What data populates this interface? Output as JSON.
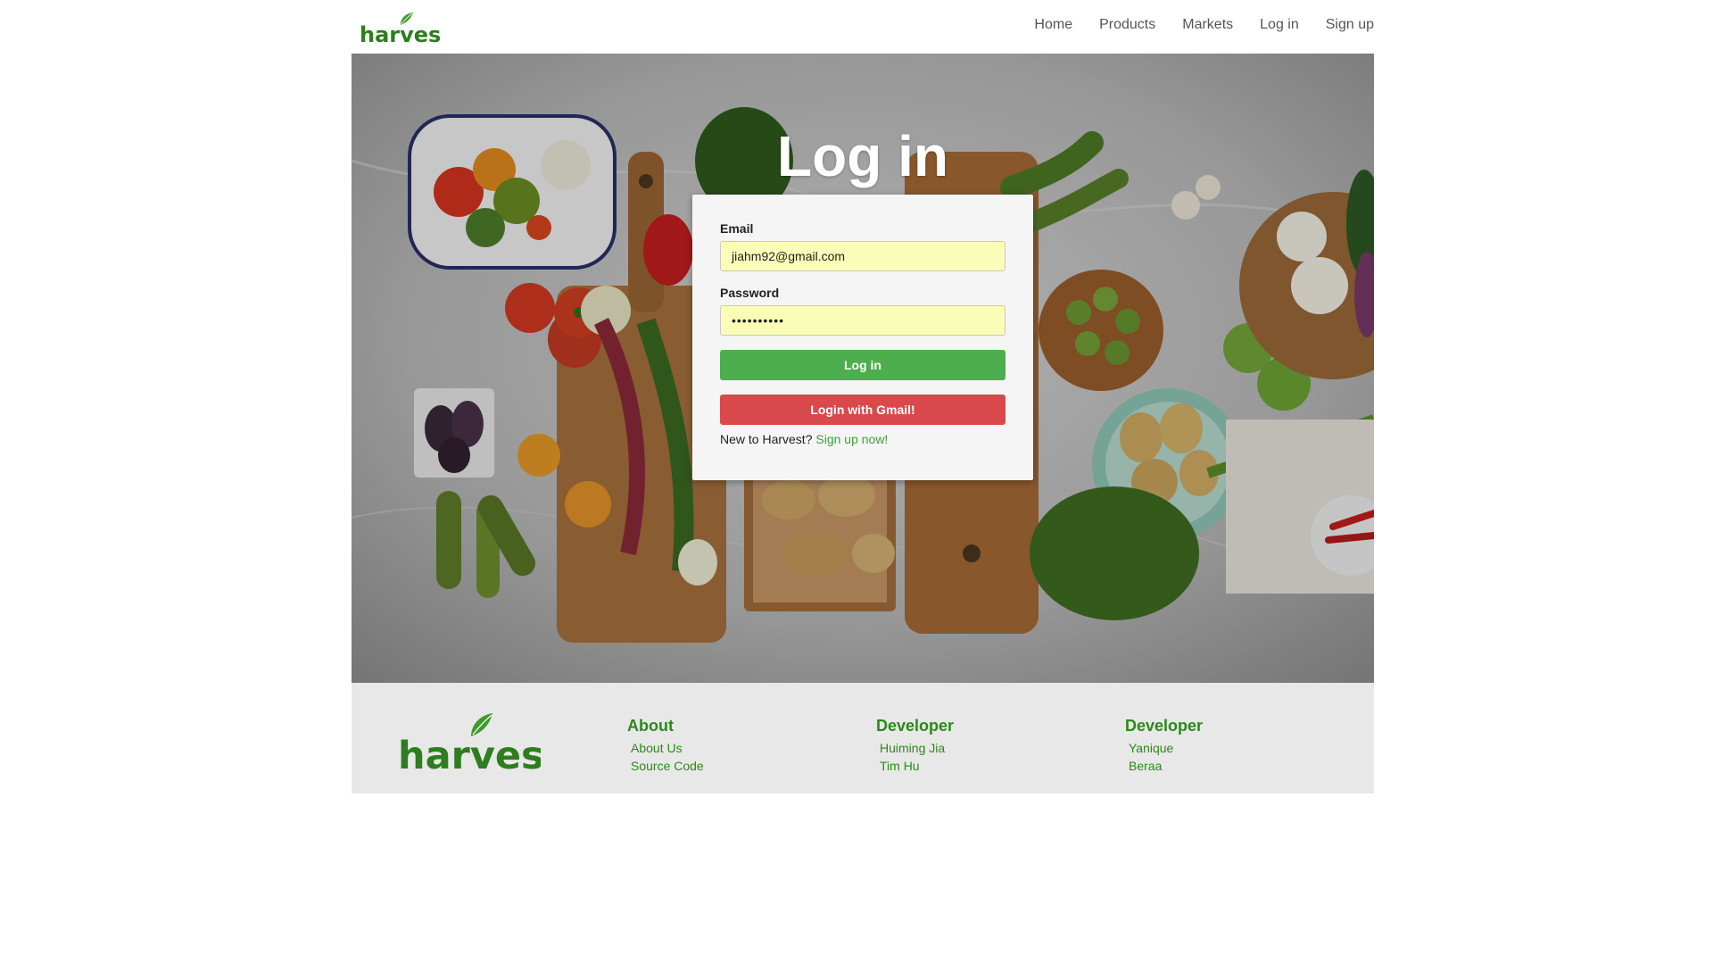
{
  "brand": {
    "logo_text": "harvest",
    "color": "#2e7d1f"
  },
  "navbar": {
    "links": [
      {
        "label": "Home"
      },
      {
        "label": "Products"
      },
      {
        "label": "Markets"
      },
      {
        "label": "Log in"
      },
      {
        "label": "Sign up"
      }
    ]
  },
  "hero": {
    "title": "Log in"
  },
  "login_form": {
    "email_label": "Email",
    "email_value": "jiahm92@gmail.com",
    "password_label": "Password",
    "password_value": "••••••••••",
    "login_button": "Log in",
    "gmail_button": "Login with Gmail!",
    "signup_prompt": "New to Harvest?",
    "signup_link": "Sign up now!",
    "colors": {
      "input_bg": "#fafdb8",
      "login_button": "#4cae4c",
      "gmail_button": "#d9484a",
      "link": "#3aa23a"
    }
  },
  "footer": {
    "columns": [
      {
        "heading": "About",
        "links": [
          "About Us",
          "Source Code"
        ]
      },
      {
        "heading": "Developer",
        "links": [
          "Huiming Jia",
          "Tim Hu"
        ]
      },
      {
        "heading": "Developer",
        "links": [
          "Yanique",
          "Beraa"
        ]
      }
    ],
    "heading_color": "#2b8a17"
  }
}
